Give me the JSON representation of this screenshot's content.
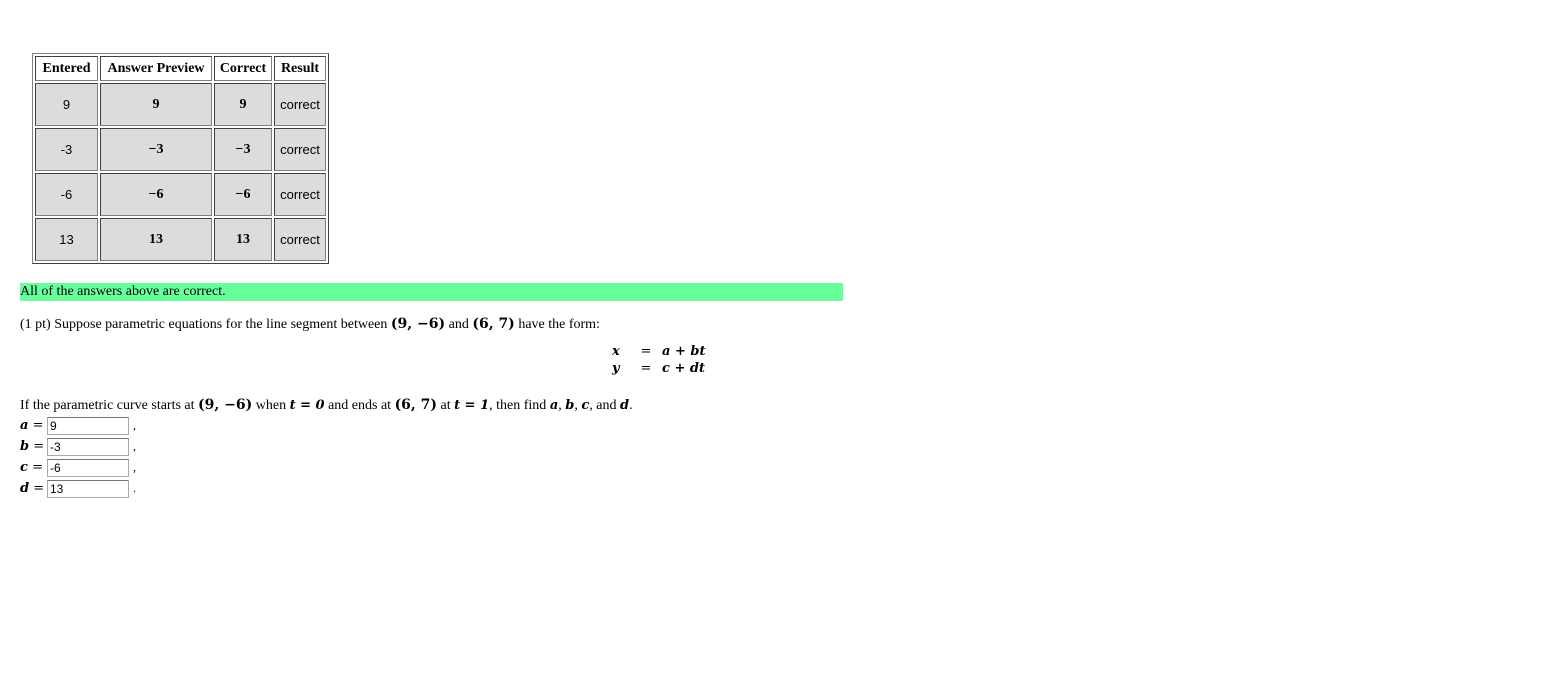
{
  "results_table": {
    "headers": [
      "Entered",
      "Answer Preview",
      "Correct",
      "Result"
    ],
    "rows": [
      {
        "entered": "9",
        "preview": "9",
        "correct": "9",
        "result": "correct"
      },
      {
        "entered": "-3",
        "preview": "−3",
        "correct": "−3",
        "result": "correct"
      },
      {
        "entered": "-6",
        "preview": "−6",
        "correct": "−6",
        "result": "correct"
      },
      {
        "entered": "13",
        "preview": "13",
        "correct": "13",
        "result": "correct"
      }
    ]
  },
  "banner": {
    "text": "All of the answers above are correct.",
    "color": "#66ff99"
  },
  "problem": {
    "points": "(1 pt)",
    "intro_text": "Suppose parametric equations for the line segment between",
    "point1": "(9, −6)",
    "and_word": "and",
    "point2": "(6, 7)",
    "intro_end": "have the form:",
    "equations": [
      {
        "lhs": "x",
        "eq": "=",
        "rhs": "a + bt"
      },
      {
        "lhs": "y",
        "eq": "=",
        "rhs": "c + dt"
      }
    ],
    "condition": {
      "t1": "If the parametric curve starts at",
      "p1": "(9, −6)",
      "t2": "when",
      "tzero": "t = 0",
      "t3": "and ends at",
      "p2": "(6, 7)",
      "t4": "at",
      "tone": "t = 1",
      "t5": ", then find",
      "va": "a",
      "c1": ",",
      "vb": "b",
      "c2": ",",
      "vc": "c",
      "t6": ", and",
      "vd": "d",
      "end": "."
    }
  },
  "answers": [
    {
      "label": "a",
      "eq": "=",
      "value": "9",
      "punct": ","
    },
    {
      "label": "b",
      "eq": "=",
      "value": "-3",
      "punct": ","
    },
    {
      "label": "c",
      "eq": "=",
      "value": "-6",
      "punct": ","
    },
    {
      "label": "d",
      "eq": "=",
      "value": "13",
      "punct": "."
    }
  ]
}
